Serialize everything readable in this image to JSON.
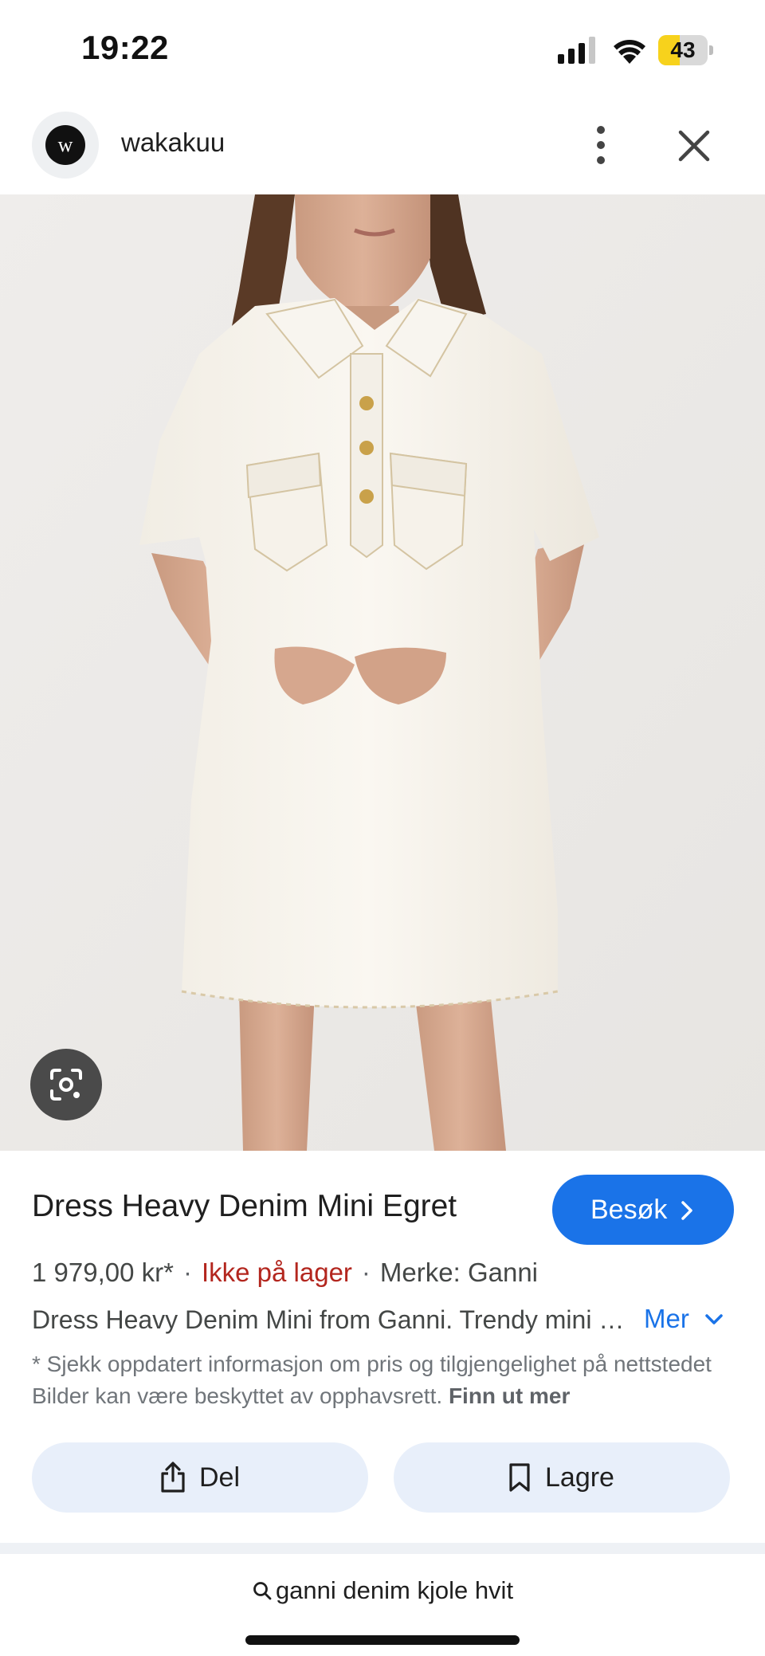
{
  "status_bar": {
    "time": "19:22",
    "battery_level": "43",
    "battery_fraction": 0.43,
    "icons": [
      "signal-icon",
      "wifi-icon",
      "battery-icon"
    ]
  },
  "header": {
    "avatar_letter": "w",
    "site_name": "wakakuu",
    "icons": [
      "more-vert-icon",
      "close-icon"
    ]
  },
  "image": {
    "subject": "model wearing white short-sleeve denim mini dress with collar, gold buttons and chest pockets",
    "lens_icon": "google-lens-icon"
  },
  "product": {
    "title": "Dress Heavy Denim Mini Egret",
    "visit_label": "Besøk",
    "price": "1 979,00 kr*",
    "separator": "·",
    "stock": "Ikke på lager",
    "brand": "Merke: Ganni",
    "description": "Dress Heavy Denim Mini from Ganni. Trendy mini dress made of heavy denim with collar and chest pockets.",
    "more_label": "Mer",
    "disclaimer": "* Sjekk oppdatert informasjon om pris og tilgjengelighet på nettstedet Bilder kan være beskyttet av opphavsrett.",
    "learn_more_label": "Finn ut mer"
  },
  "actions": {
    "share_label": "Del",
    "save_label": "Lagre"
  },
  "search": {
    "query": "ganni denim kjole hvit"
  },
  "colors": {
    "accent": "#1a73e8",
    "out_of_stock": "#b3261e",
    "action_bg": "#e8effa",
    "battery": "#f7d21c"
  }
}
